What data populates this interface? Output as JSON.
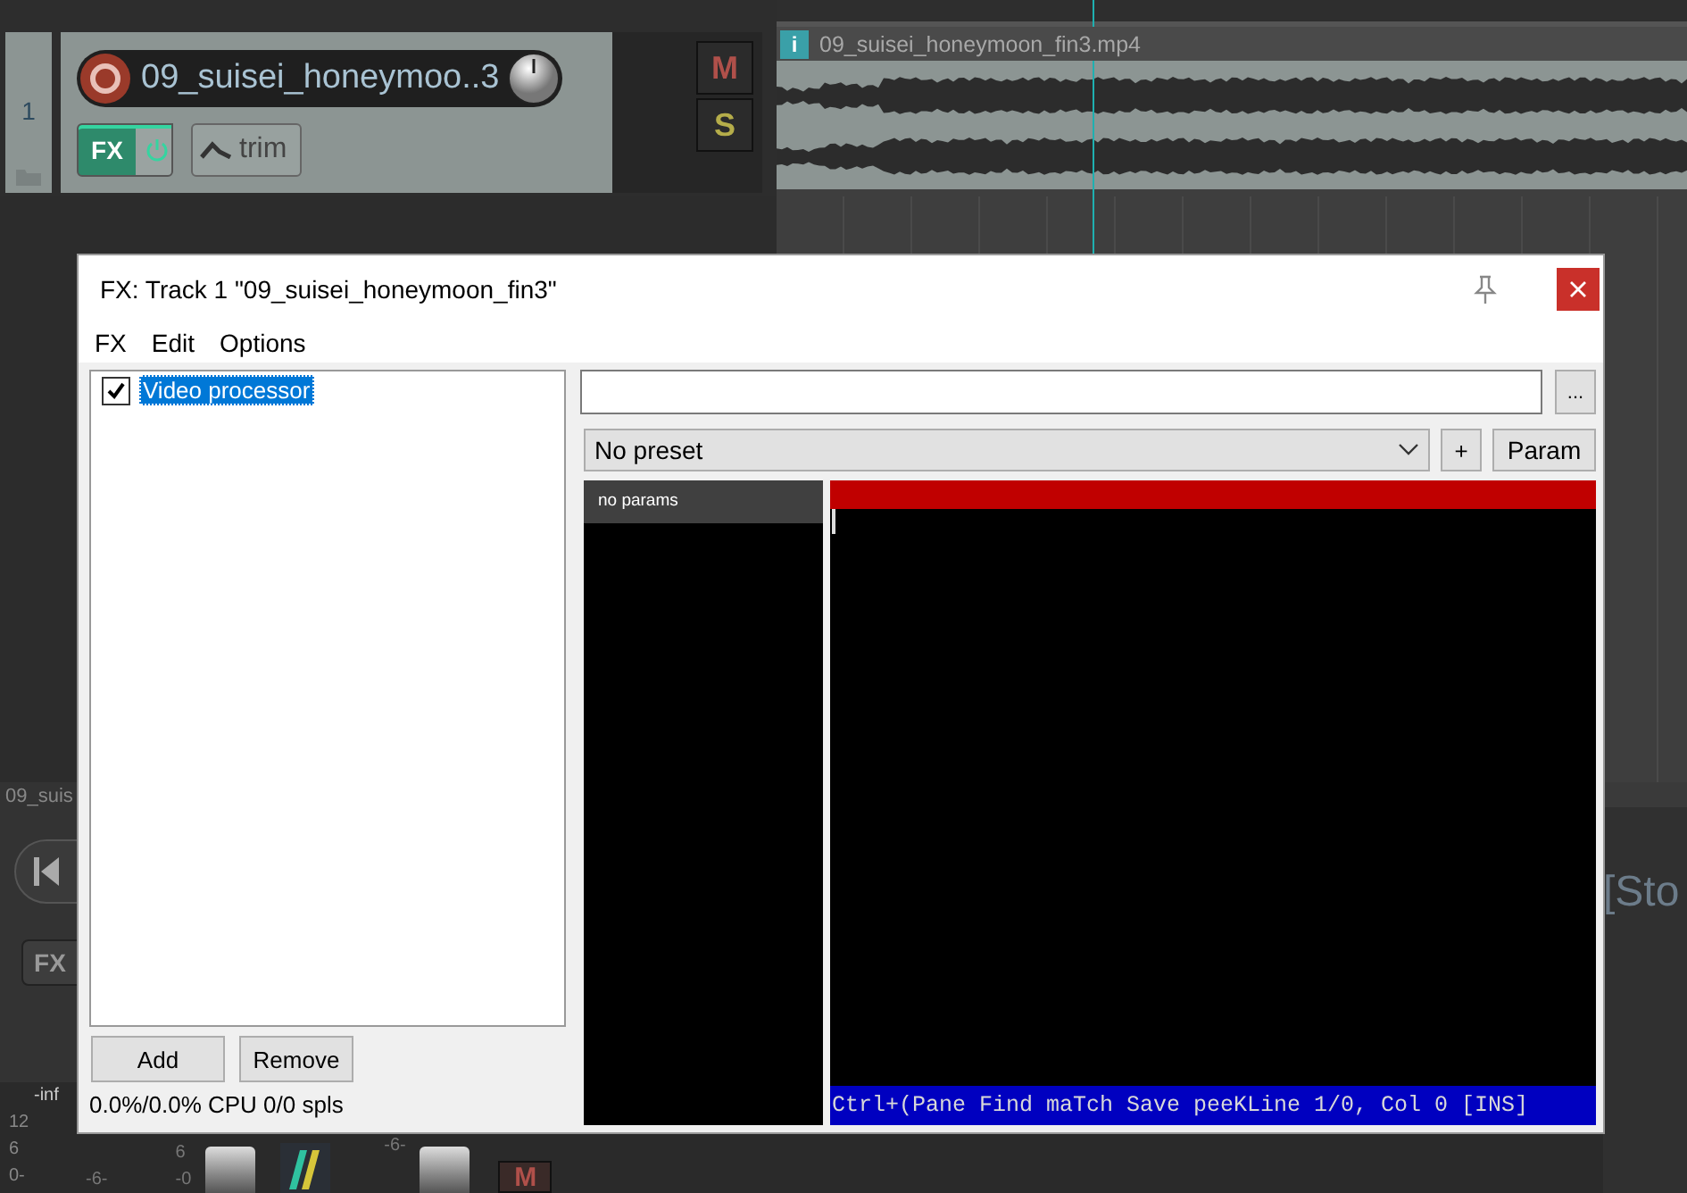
{
  "track": {
    "number": "1",
    "name": "09_suisei_honeymoo..3",
    "fx_label": "FX",
    "fx_enabled": true,
    "trim_label": "trim",
    "mute_label": "M",
    "solo_label": "S"
  },
  "media_item": {
    "info_label": "i",
    "title": "09_suisei_honeymoon_fin3.mp4"
  },
  "lower_panel": {
    "track_name": "09_suis",
    "fx_label": "FX",
    "meter_labels": [
      "-inf",
      "12",
      "6",
      "0-"
    ],
    "scale_left": "-6-",
    "scale_mid": [
      "6",
      "-0"
    ],
    "scale_right": "-6-",
    "mute_label": "M",
    "status_text": "[Sto"
  },
  "dialog": {
    "title": "FX: Track 1 \"09_suisei_honeymoon_fin3\"",
    "menu": [
      "FX",
      "Edit",
      "Options"
    ],
    "fx_list": [
      {
        "label": "Video processor",
        "checked": true,
        "selected": true
      }
    ],
    "buttons": [
      "Add",
      "Remove"
    ],
    "cpu_status": "0.0%/0.0% CPU 0/0 spls",
    "browse_label": "...",
    "preset": "No preset",
    "add_preset_label": "+",
    "param_label": "Param",
    "params_header": "no params",
    "editor_status": "Ctrl+(Pane Find maTch Save peeKLine 1/0, Col 0 [INS]"
  }
}
